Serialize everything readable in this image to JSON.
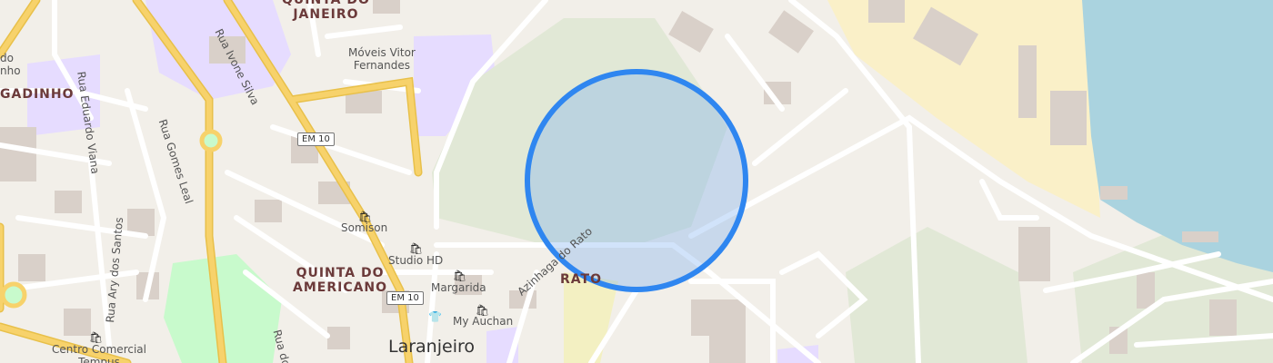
{
  "map": {
    "colors": {
      "background": "#f2efe9",
      "park": "#c8facc",
      "scrub": "#e1e8d6",
      "industrial": "#faf0c8",
      "retail": "#e6dcff",
      "water": "#aad3df",
      "residential_road": "#ffffff",
      "main_road": "#f7d26b",
      "building": "#d9d0c9",
      "highlight_fill": "#7aaef2",
      "highlight_stroke": "#2f86f0"
    },
    "districts": {
      "quinta_do_janeiro": "QUINTA DO\nJANEIRO",
      "gadinho": "GADINHO",
      "quinta_do_americano": "QUINTA DO\nAMERICANO",
      "rato": "RATO"
    },
    "town": "Laranjeiro",
    "streets": {
      "rua_ivone_silva": "Rua Ivone Silva",
      "rua_eduardo_viana": "Rua Eduardo Viana",
      "rua_gomes_leal": "Rua Gomes Leal",
      "rua_ary_dos_santos": "Rua Ary dos Santos",
      "azinhaga_do_rato": "Azinhaga do Rato",
      "rua_do": "Rua do",
      "partial_do": "do",
      "partial_nho": "nho"
    },
    "road_refs": {
      "em10_a": "EM 10",
      "em10_b": "EM 10"
    },
    "pois": {
      "moveis": "Móveis Vitor\nFernandes",
      "somison": "Somison",
      "studio_hd": "Studio HD",
      "margarida": "Margarida",
      "my_auchan": "My Auchan",
      "centro_comercial": "Centro Comercial\nTempus"
    },
    "icons": {
      "shop": "shopping-bag",
      "clothes": "shirt"
    }
  }
}
